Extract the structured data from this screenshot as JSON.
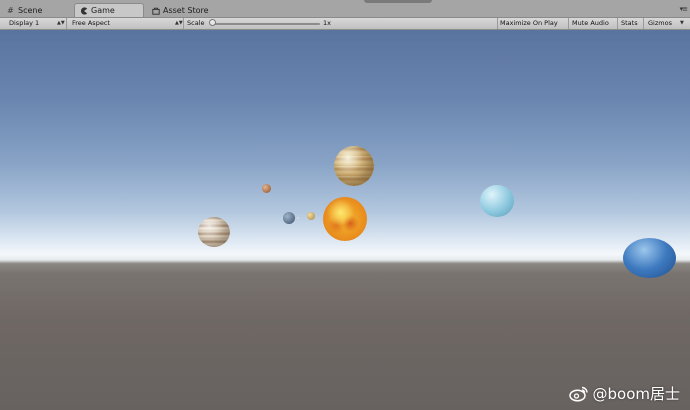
{
  "tabs": [
    {
      "label": "Scene",
      "icon": "grid-icon"
    },
    {
      "label": "Game",
      "icon": "pacman-icon"
    },
    {
      "label": "Asset Store",
      "icon": "store-icon"
    }
  ],
  "toolbar": {
    "display": "Display 1",
    "aspect": "Free Aspect",
    "scale_label": "Scale",
    "scale_value": "1x",
    "scale_level": 0.0,
    "maximize": "Maximize On Play",
    "mute": "Mute Audio",
    "stats": "Stats",
    "gizmos": "Gizmos"
  },
  "scene": {
    "planets": [
      "sun",
      "mercury",
      "venus",
      "earth",
      "mars",
      "jupiter",
      "saturn",
      "uranus",
      "neptune"
    ]
  },
  "watermark": {
    "text": "@boom居士",
    "icon": "weibo-icon"
  }
}
